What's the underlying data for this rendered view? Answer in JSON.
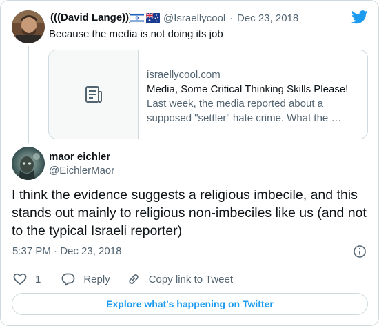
{
  "parent_tweet": {
    "display_name": "(((David Lange)))",
    "handle": "@Israellycool",
    "separator": "·",
    "date": "Dec 23, 2018",
    "text": "Because the media is not doing its job",
    "flags": [
      "flag-israel-icon",
      "flag-australia-icon"
    ],
    "link_card": {
      "domain": "israellycool.com",
      "title": "Media, Some Critical Thinking Skills Please!",
      "description": "Last week, the media reported about a supposed \"settler\" hate crime. What the …",
      "thumbnail_icon": "article-icon"
    }
  },
  "main_tweet": {
    "display_name": "maor eichler",
    "handle": "@EichlerMaor",
    "text": "I think the evidence suggests a religious imbecile, and this stands out mainly to religious non-imbeciles like us (and not to the typical Israeli reporter)",
    "timestamp": "5:37 PM · Dec 23, 2018"
  },
  "actions": {
    "like_count": "1",
    "reply_label": "Reply",
    "copy_label": "Copy link to Tweet"
  },
  "explore_label": "Explore what's happening on Twitter",
  "colors": {
    "accent": "#1d9bf0",
    "text_primary": "#0f1419",
    "text_secondary": "#536471",
    "border": "#cfd9de"
  }
}
